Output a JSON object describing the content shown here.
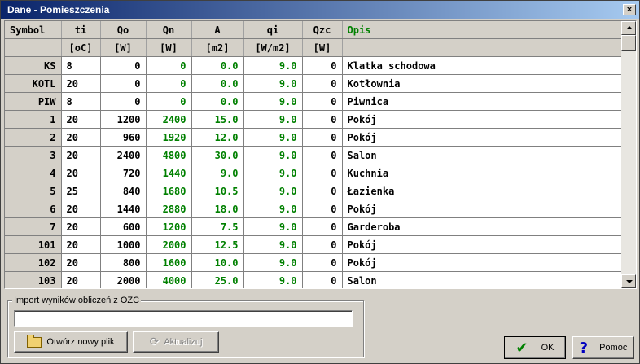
{
  "window": {
    "title": "Dane - Pomieszczenia",
    "close_glyph": "×"
  },
  "table": {
    "headers": [
      "Symbol",
      "ti",
      "Qo",
      "Qn",
      "A",
      "qi",
      "Qzc",
      "Opis"
    ],
    "units": [
      "",
      "[oC]",
      "[W]",
      "[W]",
      "[m2]",
      "[W/m2]",
      "[W]",
      ""
    ],
    "rows": [
      [
        "KS",
        "8",
        "0",
        "0",
        "0.0",
        "9.0",
        "0",
        "Klatka schodowa"
      ],
      [
        "KOTL",
        "20",
        "0",
        "0",
        "0.0",
        "9.0",
        "0",
        "Kotłownia"
      ],
      [
        "PIW",
        "8",
        "0",
        "0",
        "0.0",
        "9.0",
        "0",
        "Piwnica"
      ],
      [
        "1",
        "20",
        "1200",
        "2400",
        "15.0",
        "9.0",
        "0",
        "Pokój"
      ],
      [
        "2",
        "20",
        "960",
        "1920",
        "12.0",
        "9.0",
        "0",
        "Pokój"
      ],
      [
        "3",
        "20",
        "2400",
        "4800",
        "30.0",
        "9.0",
        "0",
        "Salon"
      ],
      [
        "4",
        "20",
        "720",
        "1440",
        "9.0",
        "9.0",
        "0",
        "Kuchnia"
      ],
      [
        "5",
        "25",
        "840",
        "1680",
        "10.5",
        "9.0",
        "0",
        "Łazienka"
      ],
      [
        "6",
        "20",
        "1440",
        "2880",
        "18.0",
        "9.0",
        "0",
        "Pokój"
      ],
      [
        "7",
        "20",
        "600",
        "1200",
        "7.5",
        "9.0",
        "0",
        "Garderoba"
      ],
      [
        "101",
        "20",
        "1000",
        "2000",
        "12.5",
        "9.0",
        "0",
        "Pokój"
      ],
      [
        "102",
        "20",
        "800",
        "1600",
        "10.0",
        "9.0",
        "0",
        "Pokój"
      ],
      [
        "103",
        "20",
        "2000",
        "4000",
        "25.0",
        "9.0",
        "0",
        "Salon"
      ]
    ]
  },
  "import_group": {
    "legend": "Import wyników obliczeń z OZC",
    "input_value": "",
    "open_button": "Otwórz nowy plik",
    "update_button": "Aktualizuj"
  },
  "footer": {
    "ok": "OK",
    "help": "Pomoc"
  },
  "colors": {
    "title_start": "#0a246a",
    "title_end": "#a6caf0",
    "green_text": "#008000",
    "opis_header": "#008000"
  },
  "icons": [
    "close-icon",
    "scroll-up-icon",
    "scroll-down-icon",
    "folder-icon",
    "refresh-icon",
    "check-icon",
    "help-icon"
  ]
}
